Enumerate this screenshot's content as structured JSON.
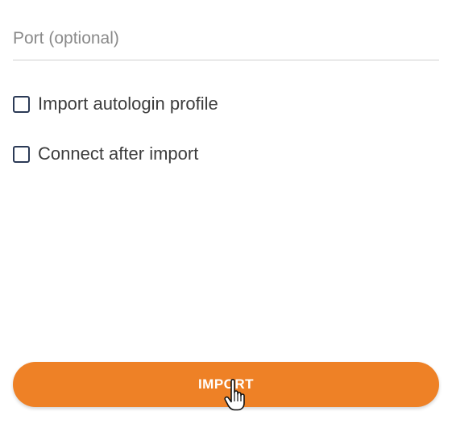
{
  "port": {
    "placeholder": "Port (optional)",
    "value": ""
  },
  "options": [
    {
      "label": "Import autologin profile",
      "checked": false
    },
    {
      "label": "Connect after import",
      "checked": false
    }
  ],
  "import_button": {
    "label": "IMPORT"
  },
  "colors": {
    "accent": "#ee8126",
    "checkbox_border": "#2b3a56"
  },
  "icons": {
    "cursor": "hand-pointer-icon"
  }
}
